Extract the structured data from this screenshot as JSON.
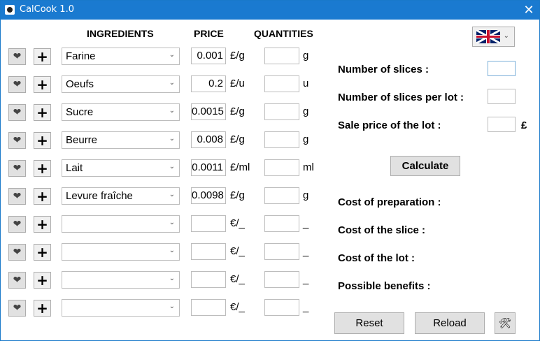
{
  "window": {
    "title": "CalCook 1.0"
  },
  "headers": {
    "ingredients": "INGREDIENTS",
    "price": "PRICE",
    "quantities": "QUANTITIES"
  },
  "rows": [
    {
      "ingredient": "Farine",
      "price": "0.001",
      "price_unit": "£/g",
      "quantity": "",
      "qty_unit": "g"
    },
    {
      "ingredient": "Oeufs",
      "price": "0.2",
      "price_unit": "£/u",
      "quantity": "",
      "qty_unit": "u"
    },
    {
      "ingredient": "Sucre",
      "price": "0.0015",
      "price_unit": "£/g",
      "quantity": "",
      "qty_unit": "g"
    },
    {
      "ingredient": "Beurre",
      "price": "0.008",
      "price_unit": "£/g",
      "quantity": "",
      "qty_unit": "g"
    },
    {
      "ingredient": "Lait",
      "price": "0.0011",
      "price_unit": "£/ml",
      "quantity": "",
      "qty_unit": "ml"
    },
    {
      "ingredient": "Levure fraîche",
      "price": "0.0098",
      "price_unit": "£/g",
      "quantity": "",
      "qty_unit": "g"
    },
    {
      "ingredient": "",
      "price": "",
      "price_unit": "€/_",
      "quantity": "",
      "qty_unit": "_"
    },
    {
      "ingredient": "",
      "price": "",
      "price_unit": "€/_",
      "quantity": "",
      "qty_unit": "_"
    },
    {
      "ingredient": "",
      "price": "",
      "price_unit": "€/_",
      "quantity": "",
      "qty_unit": "_"
    },
    {
      "ingredient": "",
      "price": "",
      "price_unit": "€/_",
      "quantity": "",
      "qty_unit": "_"
    }
  ],
  "icons": {
    "row_heart": "heart-icon",
    "row_add": "plus-icon",
    "dropdown": "chevron-down-icon",
    "language": "uk-flag-icon",
    "settings": "tools-icon",
    "close": "close-icon"
  },
  "right_panel": {
    "number_of_slices_label": "Number of slices :",
    "number_of_slices_value": "",
    "slices_per_lot_label": "Number of slices per lot :",
    "slices_per_lot_value": "",
    "sale_price_label": "Sale price of the lot :",
    "sale_price_value": "",
    "currency_symbol": "£",
    "calculate_label": "Calculate",
    "cost_preparation_label": "Cost of preparation :",
    "cost_slice_label": "Cost of the slice :",
    "cost_lot_label": "Cost of the lot :",
    "possible_benefits_label": "Possible benefits :",
    "reset_label": "Reset",
    "reload_label": "Reload"
  },
  "colors": {
    "titlebar": "#1a7ad0",
    "button_face": "#e1e1e1",
    "field_border": "#bdbdbd",
    "focus_border": "#7aaed8"
  }
}
